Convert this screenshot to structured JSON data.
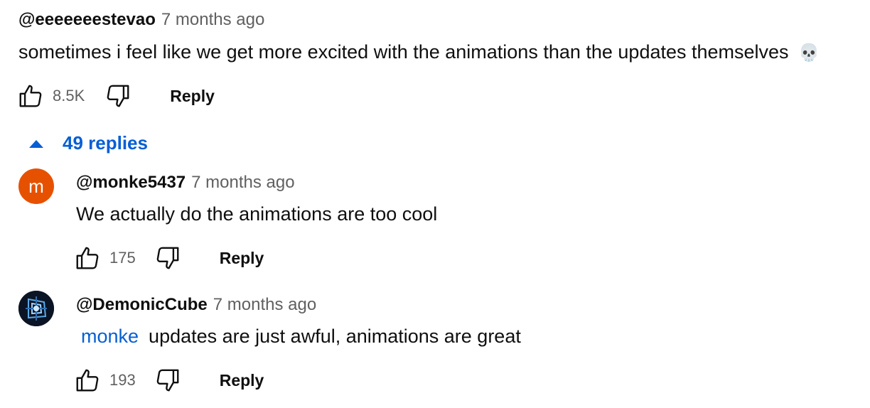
{
  "main_comment": {
    "handle": "@eeeeeeestevao",
    "time": "7 months ago",
    "text": "sometimes i feel like we get more excited with the animations than the updates themselves",
    "emoji": "💀",
    "likes": "8.5K",
    "reply_label": "Reply"
  },
  "replies_toggle": {
    "label": "49 replies",
    "icon": "caret-up-icon"
  },
  "replies": [
    {
      "avatar_letter": "m",
      "avatar_color": "#e65100",
      "handle": "@monke5437",
      "time": "7 months ago",
      "text": "We actually do the animations are too cool",
      "likes": "175",
      "reply_label": "Reply"
    },
    {
      "handle": "@DemonicCube",
      "time": "7 months ago",
      "mention": "monke",
      "text": "updates are just awful, animations are great",
      "likes": "193",
      "reply_label": "Reply"
    }
  ],
  "colors": {
    "link_blue": "#065fd4",
    "secondary_text": "#606060",
    "primary_text": "#0f0f0f"
  }
}
